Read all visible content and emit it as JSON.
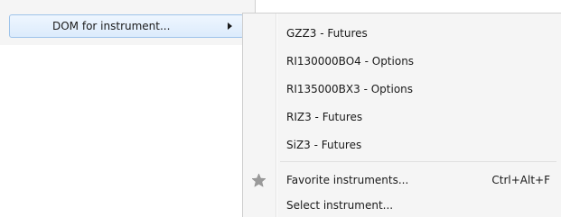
{
  "parent_menu": {
    "item_label": "DOM for instrument..."
  },
  "submenu": {
    "instruments": [
      {
        "label": "GZZ3 - Futures"
      },
      {
        "label": "RI130000BO4 - Options"
      },
      {
        "label": "RI135000BX3 - Options"
      },
      {
        "label": "RIZ3 - Futures"
      },
      {
        "label": "SiZ3 - Futures"
      }
    ],
    "favorites": {
      "label": "Favorite instruments...",
      "shortcut": "Ctrl+Alt+F",
      "icon": "star-icon"
    },
    "select": {
      "label": "Select instrument..."
    }
  },
  "colors": {
    "menu_bg": "#f5f5f5",
    "highlight_border": "#9ec3ea",
    "highlight_bg": "#dcebfc",
    "star_icon": "#9a9a9a"
  }
}
